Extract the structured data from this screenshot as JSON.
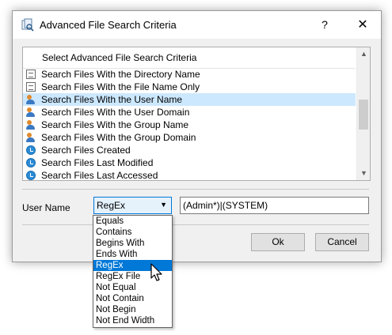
{
  "window": {
    "title": "Advanced File Search Criteria",
    "help_label": "?",
    "close_label": "✕"
  },
  "list": {
    "header": "Select Advanced File Search Criteria",
    "items": [
      {
        "label": "Search Files With the Directory Name",
        "icon": "document-icon",
        "selected": false
      },
      {
        "label": "Search Files With the File Name Only",
        "icon": "document-icon",
        "selected": false
      },
      {
        "label": "Search Files With the User Name",
        "icon": "user-icon",
        "selected": true
      },
      {
        "label": "Search Files With the User Domain",
        "icon": "user-icon",
        "selected": false
      },
      {
        "label": "Search Files With the Group Name",
        "icon": "user-icon",
        "selected": false
      },
      {
        "label": "Search Files With the Group Domain",
        "icon": "user-icon",
        "selected": false
      },
      {
        "label": "Search Files Created",
        "icon": "clock-icon",
        "selected": false
      },
      {
        "label": "Search Files Last Modified",
        "icon": "clock-icon",
        "selected": false
      },
      {
        "label": "Search Files Last Accessed",
        "icon": "clock-icon",
        "selected": false
      }
    ]
  },
  "criteria": {
    "field_label": "User Name",
    "match_type": "RegEx",
    "value": "(Admin*)|(SYSTEM)"
  },
  "dropdown": {
    "options": [
      "Equals",
      "Contains",
      "Begins With",
      "Ends With",
      "RegEx",
      "RegEx File",
      "Not Equal",
      "Not Contain",
      "Not Begin",
      "Not End Width"
    ],
    "selected": "RegEx"
  },
  "buttons": {
    "ok": "Ok",
    "cancel": "Cancel"
  },
  "colors": {
    "selection": "#0078d7",
    "list_selection": "#cce8ff",
    "dialog_bg": "#f0f0f0"
  }
}
